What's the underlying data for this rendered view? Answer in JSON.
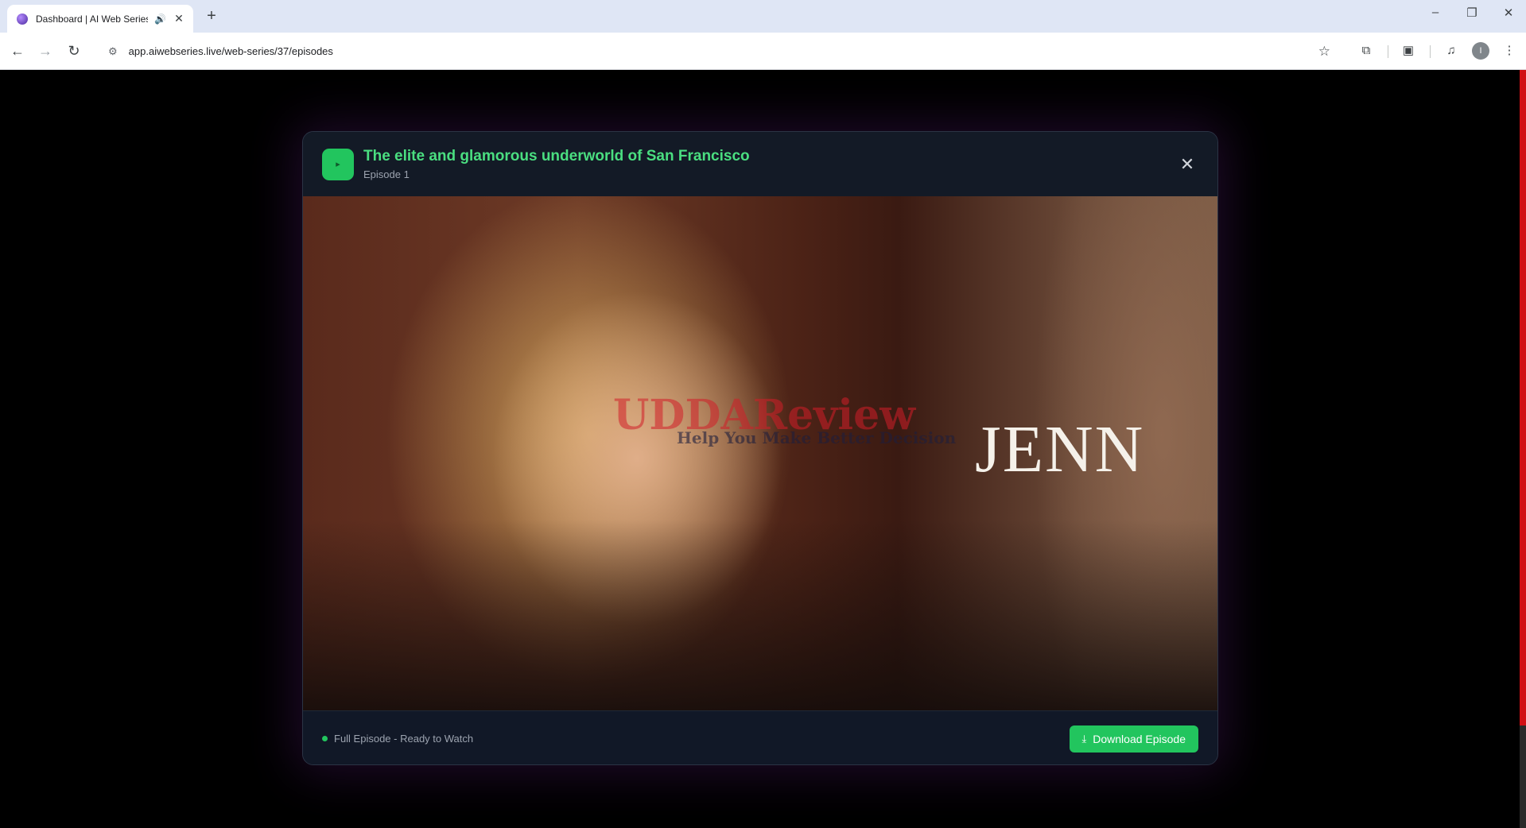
{
  "browser": {
    "tab": {
      "title": "Dashboard | AI Web Series",
      "audio_icon": "🔊",
      "close_icon": "✕"
    },
    "new_tab_icon": "+",
    "window": {
      "minimize": "–",
      "restore": "❐",
      "close": "✕"
    },
    "nav": {
      "back": "←",
      "forward": "→",
      "reload": "↻"
    },
    "url": "app.aiwebseries.live/web-series/37/episodes",
    "site_info_icon": "⚙",
    "bookmark_icon": "☆",
    "toolbar_icons": {
      "extensions": "⧉",
      "screen": "▣",
      "media": "♫",
      "menu": "⋮"
    },
    "profile_initial": "I"
  },
  "modal": {
    "title": "The elite and glamorous underworld of San Francisco",
    "subtitle": "Episode 1",
    "close_icon": "✕",
    "play_icon": "▸",
    "video": {
      "caption": "JENN",
      "watermark": "UDDAReview",
      "watermark_tagline": "Help You Make Better Decision"
    },
    "footer": {
      "status": "Full Episode - Ready to Watch",
      "download_label": "Download Episode",
      "download_icon": "⤓"
    }
  },
  "colors": {
    "accent_green": "#22c55e",
    "title_green": "#4ade80",
    "scrollbar_red": "#d10f14"
  }
}
